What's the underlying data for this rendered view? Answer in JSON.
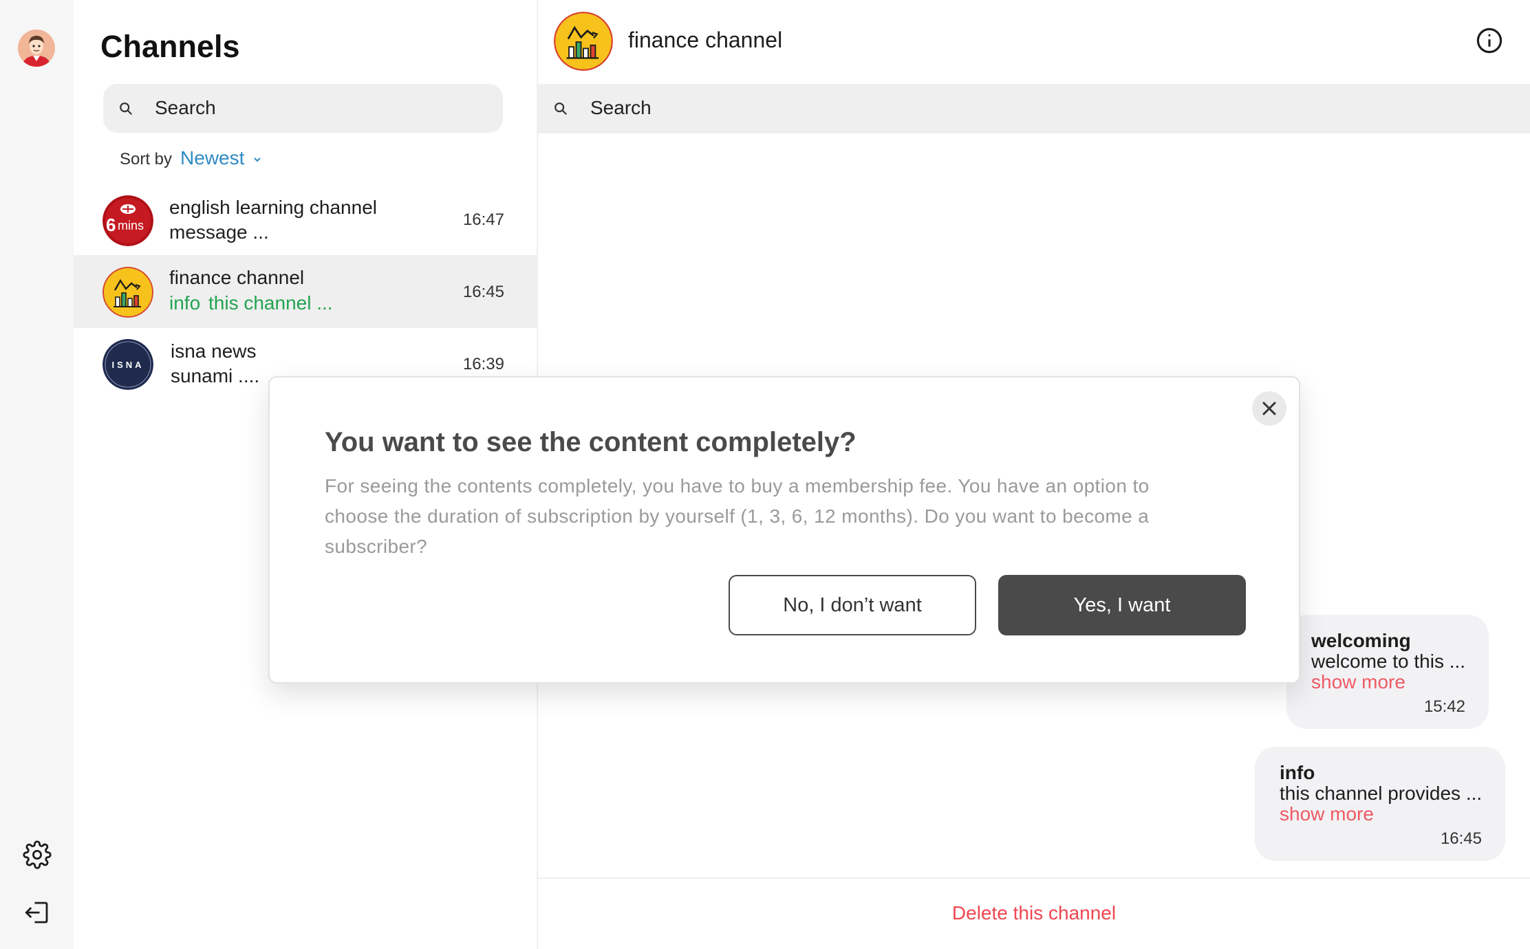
{
  "sidebar": {
    "avatar_icon": "user-avatar",
    "settings_icon": "gear-icon",
    "logout_icon": "logout-icon"
  },
  "channels_panel": {
    "title": "Channels",
    "search_placeholder": "Search",
    "sort_label": "Sort by",
    "sort_value": "Newest",
    "items": [
      {
        "name": "english learning channel",
        "preview": "message ...",
        "time": "16:47",
        "avatar_text": "6mins",
        "avatar_color": "#b01017"
      },
      {
        "name": "finance channel",
        "preview_tag": "info",
        "preview": "this channel ...",
        "time": "16:45",
        "avatar_color": "#f8c21c"
      },
      {
        "name": "isna news",
        "preview": "sunami ....",
        "time": "16:39",
        "avatar_text": "ISNA",
        "avatar_color": "#1f2a4d"
      }
    ]
  },
  "chat": {
    "title": "finance channel",
    "search_placeholder": "Search",
    "messages": [
      {
        "title": "welcoming",
        "text": "welcome to this ...",
        "more": "show more",
        "time": "15:42"
      },
      {
        "title": "info",
        "text": "this channel provides ...",
        "more": "show more",
        "time": "16:45"
      }
    ],
    "delete_label": "Delete this channel"
  },
  "modal": {
    "title": "You want to see the content completely?",
    "body": "For seeing the contents completely, you have to buy a membership fee. You have an option to choose the duration of subscription by yourself (1, 3, 6, 12 months). Do you want to become a subscriber?",
    "no_label": "No, I don’t want",
    "yes_label": "Yes, I want"
  },
  "colors": {
    "accent_blue": "#2f8ac4",
    "preview_green": "#22a451",
    "danger_red": "#ef4650",
    "show_more": "#ef5a63",
    "dark_button": "#4a4a4a"
  }
}
